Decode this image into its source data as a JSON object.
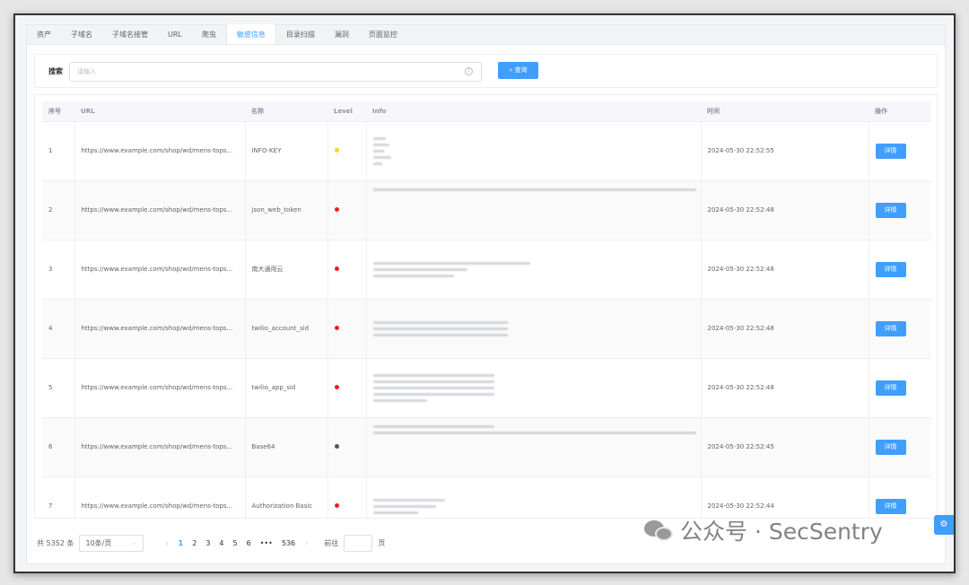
{
  "tabs": [
    "资产",
    "子域名",
    "子域名接管",
    "URL",
    "爬虫",
    "敏感信息",
    "目录扫描",
    "漏洞",
    "页面监控"
  ],
  "active_tab": "敏感信息",
  "search": {
    "label": "搜索",
    "placeholder": "请输入",
    "button": "查询"
  },
  "table": {
    "columns": [
      "序号",
      "URL",
      "名称",
      "Level",
      "Info",
      "时间",
      "操作"
    ],
    "rows": [
      {
        "index": "1",
        "url": "https://www.example.com/shop/wd/mens-tops...",
        "name": "INFO-KEY",
        "level_color": "#f5d90a",
        "time": "2024-05-30 22:52:55",
        "action": "详情"
      },
      {
        "index": "2",
        "url": "https://www.example.com/shop/wd/mens-tops...",
        "name": "json_web_token",
        "level_color": "#ff1a1a",
        "time": "2024-05-30 22:52:48",
        "action": "详情"
      },
      {
        "index": "3",
        "url": "https://www.example.com/shop/wd/mens-tops...",
        "name": "南大通用云",
        "level_color": "#ff1a1a",
        "time": "2024-05-30 22:52:48",
        "action": "详情"
      },
      {
        "index": "4",
        "url": "https://www.example.com/shop/wd/mens-tops...",
        "name": "twilio_account_sid",
        "level_color": "#ff1a1a",
        "time": "2024-05-30 22:52:48",
        "action": "详情"
      },
      {
        "index": "5",
        "url": "https://www.example.com/shop/wd/mens-tops...",
        "name": "twilio_app_sid",
        "level_color": "#ff1a1a",
        "time": "2024-05-30 22:52:48",
        "action": "详情"
      },
      {
        "index": "6",
        "url": "https://www.example.com/shop/wd/mens-tops...",
        "name": "Base64",
        "level_color": "#555555",
        "time": "2024-05-30 22:52:45",
        "action": "详情"
      },
      {
        "index": "7",
        "url": "https://www.example.com/shop/wd/mens-tops...",
        "name": "Authorization Basic",
        "level_color": "#ff1a1a",
        "time": "2024-05-30 22:52:44",
        "action": "详情"
      }
    ]
  },
  "pagination": {
    "total": "共 5352 条",
    "page_size": "10条/页",
    "pages": [
      "1",
      "2",
      "3",
      "4",
      "5",
      "6",
      "•••",
      "536"
    ],
    "current": "1",
    "goto_label": "前往",
    "goto_suffix": "页"
  },
  "watermark": "公众号 · SecSentry",
  "accent_color": "#409eff"
}
